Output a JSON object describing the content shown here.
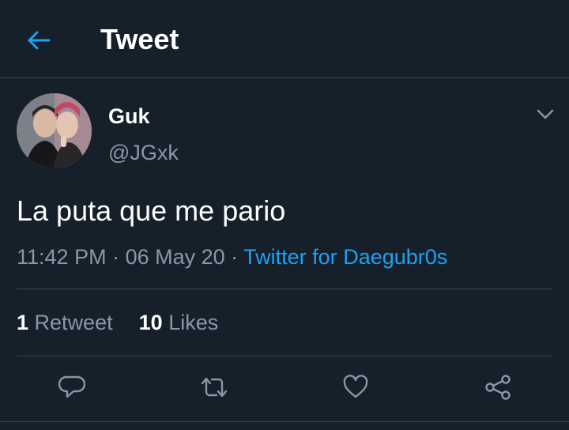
{
  "header": {
    "title": "Tweet",
    "back_icon": "arrow-left-icon"
  },
  "colors": {
    "background": "#15202b",
    "accent": "#1da1f2",
    "muted": "#8899a6",
    "divider": "#38444d"
  },
  "tweet": {
    "display_name": "Guk",
    "handle": "@JGxk",
    "text": "La puta que me pario",
    "time": "11:42 PM",
    "separator": " · ",
    "date": "06 May 20",
    "source": "Twitter for Daegubr0s"
  },
  "stats": {
    "retweets_count": "1",
    "retweets_label": "Retweet",
    "likes_count": "10",
    "likes_label": "Likes"
  },
  "actions": [
    "reply-icon",
    "retweet-icon",
    "like-icon",
    "share-icon"
  ]
}
